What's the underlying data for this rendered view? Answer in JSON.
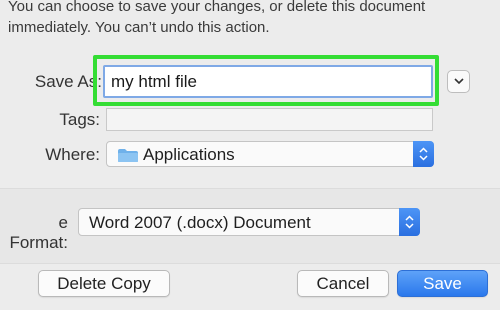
{
  "dialog": {
    "message": "You can choose to save your changes, or delete this document\nimmediately. You can’t undo this action."
  },
  "save_as": {
    "label": "Save As:",
    "value": "my html file"
  },
  "tags": {
    "label": "Tags:",
    "value": ""
  },
  "where": {
    "label": "Where:",
    "value": "Applications",
    "icon": "folder-icon"
  },
  "file_format": {
    "label": "e Format:",
    "value": "Word 2007 (.docx) Document"
  },
  "buttons": {
    "delete_copy": "Delete Copy",
    "cancel": "Cancel",
    "save": "Save"
  },
  "colors": {
    "highlight": "#34dd34",
    "accent": "#2a78ec"
  }
}
